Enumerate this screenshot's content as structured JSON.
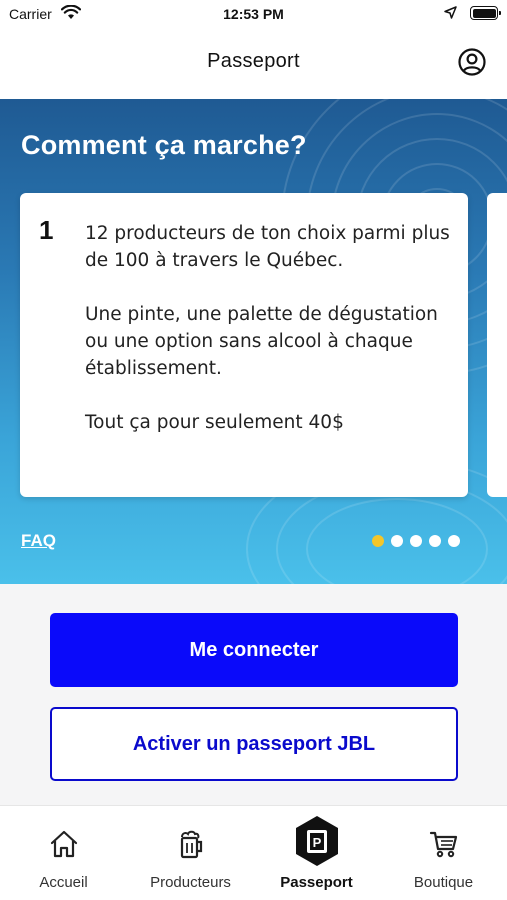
{
  "status_bar": {
    "carrier": "Carrier",
    "time": "12:53 PM"
  },
  "header": {
    "title": "Passeport",
    "profile_icon": "user-circle-icon"
  },
  "hero": {
    "title": "Comment ça marche?",
    "card": {
      "number": "1",
      "paragraphs": [
        "12 producteurs de ton choix parmi plus de 100 à travers le Québec.",
        "Une pinte, une palette de dégustation ou une option sans alcool à chaque établissement.",
        "Tout ça pour seulement 40$"
      ]
    },
    "faq_label": "FAQ",
    "pager": {
      "count": 5,
      "active_index": 0
    }
  },
  "actions": {
    "login_label": "Me connecter",
    "activate_label": "Activer un passeport JBL"
  },
  "tabs": [
    {
      "label": "Accueil",
      "icon": "home-icon",
      "active": false
    },
    {
      "label": "Producteurs",
      "icon": "beer-mug-icon",
      "active": false
    },
    {
      "label": "Passeport",
      "icon": "passport-badge-icon",
      "active": true
    },
    {
      "label": "Boutique",
      "icon": "cart-icon",
      "active": false
    }
  ],
  "colors": {
    "primary_blue": "#0a0afa",
    "outline_blue": "#0a0acc",
    "hero_top": "#1f5a93",
    "hero_bottom": "#4ac0ea",
    "pager_active": "#f3c62a"
  }
}
